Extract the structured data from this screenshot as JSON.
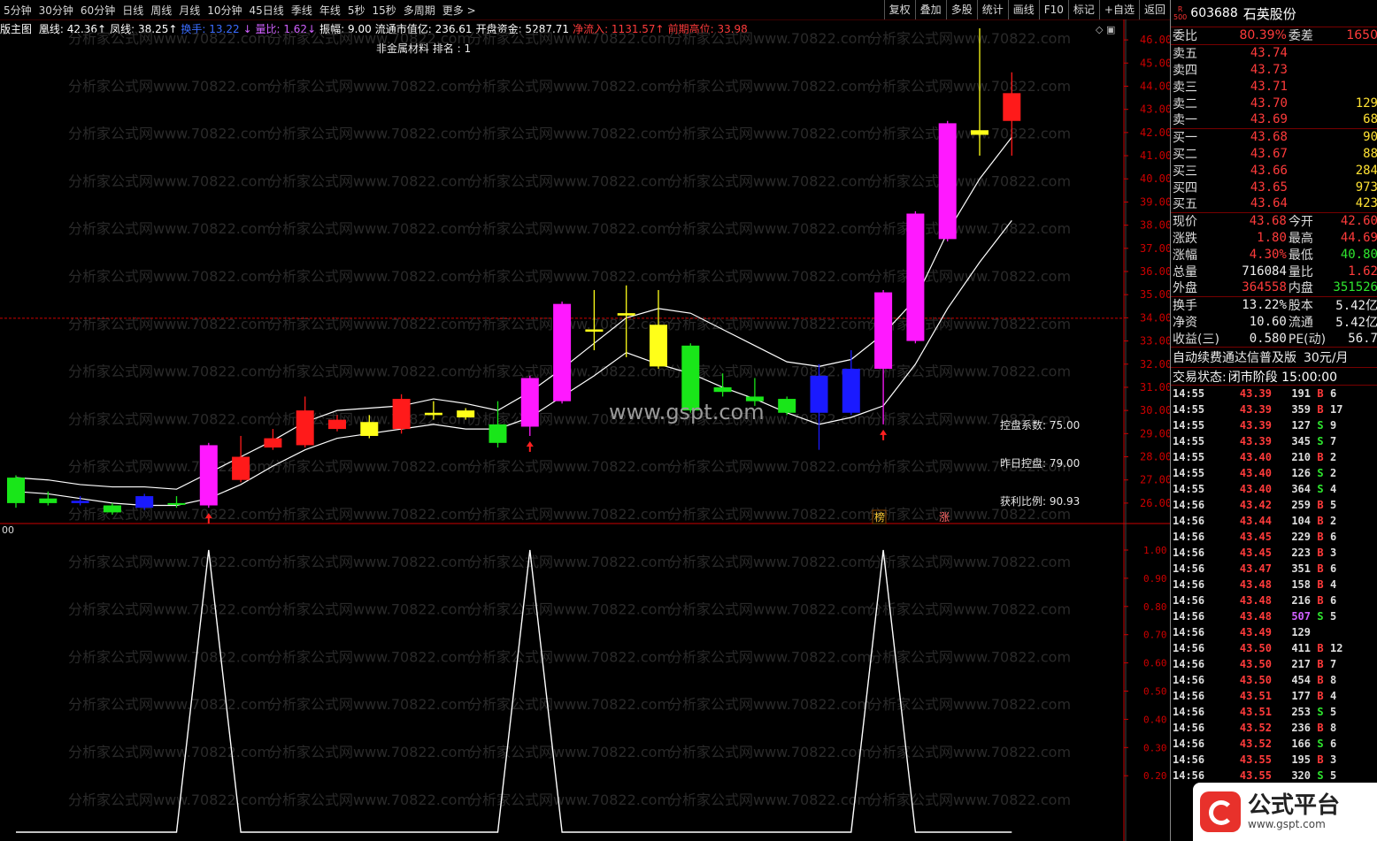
{
  "topbar": {
    "periods": [
      "5分钟",
      "30分钟",
      "60分钟",
      "日线",
      "周线",
      "月线",
      "10分钟",
      "45日线",
      "季线",
      "年线",
      "5秒",
      "15秒",
      "多周期",
      "更多 >"
    ],
    "tools": [
      "复权",
      "叠加",
      "多股",
      "统计",
      "画线",
      "F10",
      "标记",
      "+自选",
      "返回"
    ]
  },
  "infobar": {
    "main_label": "版主图",
    "items": [
      {
        "text": "凰线: 42.36↑",
        "color": "#ffffff"
      },
      {
        "text": "凤线: 38.25↑",
        "color": "#ffffff"
      },
      {
        "text": "换手: 13.22",
        "color": "#3a6cff"
      },
      {
        "text": "↓ 量比: 1.62↓",
        "color": "#d060ff"
      },
      {
        "text": "振幅: 9.00",
        "color": "#ffffff"
      },
      {
        "text": "流通市值亿: 236.61",
        "color": "#ffffff"
      },
      {
        "text": "开盘资金: 5287.71",
        "color": "#ffffff"
      },
      {
        "text": "净流入: 1131.57↑",
        "color": "#ff3b3b"
      },
      {
        "text": "前期高位: 33.98",
        "color": "#ff3b3b"
      }
    ]
  },
  "subtitle": "非金属材料 排名 : 1",
  "panel_info": {
    "control_coef": "控盘系数: 75.00",
    "yesterday_control": "昨日控盘: 79.00",
    "profit_ratio": "获利比例: 90.93"
  },
  "watermark": "分析家公式网www.70822.com",
  "site_watermark": "www.gspt.com",
  "markers": {
    "bang": "榜",
    "zhang": "涨"
  },
  "subpanel_label": "00",
  "colors": {
    "bg": "#000000",
    "magenta": "#ff19ff",
    "red": "#ff1a1a",
    "green": "#19e619",
    "yellow": "#ffff19",
    "blue": "#1a1aff",
    "axis_red": "#cc0000",
    "grid_dashed": "#cc0000",
    "line": "#ffffff",
    "up_text": "#ff3b3b",
    "down_text": "#2fe62f"
  },
  "chart_data": [
    {
      "type": "candlestick",
      "title": "",
      "y_ticks": [
        "46.00",
        "45.00",
        "44.00",
        "43.00",
        "42.00",
        "41.00",
        "40.00",
        "39.00",
        "38.00",
        "37.00",
        "36.00",
        "35.00",
        "34.00",
        "33.00",
        "32.00",
        "31.00",
        "30.00",
        "29.00",
        "28.00",
        "27.00",
        "26.00"
      ],
      "ylim": [
        25.5,
        46.5
      ],
      "reference_line": 33.98,
      "candles": [
        {
          "o": 27.1,
          "c": 26.0,
          "h": 27.2,
          "l": 25.8,
          "color": "green"
        },
        {
          "o": 26.2,
          "c": 26.0,
          "h": 26.5,
          "l": 25.9,
          "color": "green"
        },
        {
          "o": 26.1,
          "c": 26.0,
          "h": 26.3,
          "l": 25.9,
          "color": "blue"
        },
        {
          "o": 25.9,
          "c": 25.6,
          "h": 26.0,
          "l": 25.5,
          "color": "green"
        },
        {
          "o": 26.3,
          "c": 25.8,
          "h": 26.4,
          "l": 25.7,
          "color": "blue"
        },
        {
          "o": 26.0,
          "c": 26.0,
          "h": 26.3,
          "l": 25.8,
          "color": "green"
        },
        {
          "o": 25.9,
          "c": 28.5,
          "h": 28.6,
          "l": 25.8,
          "color": "magenta"
        },
        {
          "o": 27.0,
          "c": 28.0,
          "h": 28.9,
          "l": 26.9,
          "color": "red"
        },
        {
          "o": 28.4,
          "c": 28.8,
          "h": 29.2,
          "l": 28.3,
          "color": "red"
        },
        {
          "o": 28.5,
          "c": 30.0,
          "h": 30.6,
          "l": 28.4,
          "color": "red"
        },
        {
          "o": 29.2,
          "c": 29.6,
          "h": 29.8,
          "l": 29.1,
          "color": "red"
        },
        {
          "o": 28.9,
          "c": 29.5,
          "h": 29.8,
          "l": 28.8,
          "color": "yellow"
        },
        {
          "o": 29.2,
          "c": 30.5,
          "h": 30.7,
          "l": 29.0,
          "color": "red"
        },
        {
          "o": 29.9,
          "c": 29.8,
          "h": 30.4,
          "l": 29.6,
          "color": "yellow"
        },
        {
          "o": 29.7,
          "c": 30.0,
          "h": 30.1,
          "l": 29.6,
          "color": "yellow"
        },
        {
          "o": 29.4,
          "c": 28.6,
          "h": 30.4,
          "l": 28.4,
          "color": "green"
        },
        {
          "o": 29.3,
          "c": 31.4,
          "h": 31.5,
          "l": 28.9,
          "color": "magenta"
        },
        {
          "o": 30.4,
          "c": 34.6,
          "h": 34.7,
          "l": 30.3,
          "color": "magenta"
        },
        {
          "o": 33.4,
          "c": 33.5,
          "h": 35.2,
          "l": 32.6,
          "color": "yellow"
        },
        {
          "o": 34.2,
          "c": 34.1,
          "h": 35.4,
          "l": 32.3,
          "color": "yellow"
        },
        {
          "o": 33.7,
          "c": 31.9,
          "h": 35.2,
          "l": 31.8,
          "color": "yellow"
        },
        {
          "o": 32.8,
          "c": 30.0,
          "h": 32.9,
          "l": 29.9,
          "color": "green"
        },
        {
          "o": 31.0,
          "c": 30.8,
          "h": 31.6,
          "l": 30.6,
          "color": "green"
        },
        {
          "o": 30.6,
          "c": 30.4,
          "h": 31.4,
          "l": 30.2,
          "color": "green"
        },
        {
          "o": 30.5,
          "c": 29.9,
          "h": 30.6,
          "l": 29.8,
          "color": "green"
        },
        {
          "o": 29.9,
          "c": 31.5,
          "h": 32.0,
          "l": 28.3,
          "color": "blue"
        },
        {
          "o": 29.9,
          "c": 31.8,
          "h": 32.6,
          "l": 29.8,
          "color": "blue"
        },
        {
          "o": 31.8,
          "c": 35.1,
          "h": 35.2,
          "l": 29.4,
          "color": "magenta"
        },
        {
          "o": 33.0,
          "c": 38.5,
          "h": 38.6,
          "l": 32.9,
          "color": "magenta"
        },
        {
          "o": 37.4,
          "c": 42.4,
          "h": 42.5,
          "l": 37.3,
          "color": "magenta"
        },
        {
          "o": 41.9,
          "c": 42.1,
          "h": 46.5,
          "l": 41.0,
          "color": "yellow"
        },
        {
          "o": 42.5,
          "c": 43.7,
          "h": 44.6,
          "l": 41.0,
          "color": "red"
        }
      ],
      "series": [
        {
          "values": [
            27.1,
            27.0,
            26.8,
            26.7,
            26.7,
            26.6,
            27.3,
            28.0,
            28.7,
            29.5,
            30.0,
            30.1,
            30.2,
            30.5,
            30.3,
            30.0,
            30.8,
            31.8,
            32.9,
            34.0,
            34.4,
            34.2,
            33.5,
            32.8,
            32.1,
            31.9,
            32.2,
            33.3,
            34.8,
            37.7,
            40.0,
            41.8
          ]
        },
        {
          "values": [
            26.5,
            26.4,
            26.2,
            26.0,
            25.9,
            25.9,
            26.2,
            26.8,
            27.6,
            28.3,
            28.8,
            29.0,
            29.2,
            29.4,
            29.2,
            29.2,
            29.7,
            30.6,
            31.5,
            32.5,
            32.0,
            31.6,
            31.0,
            30.5,
            29.9,
            29.4,
            29.7,
            30.2,
            32.0,
            34.4,
            36.4,
            38.2
          ]
        }
      ],
      "up_arrows_at": [
        6,
        16,
        27
      ]
    },
    {
      "type": "line",
      "title": "",
      "y_ticks": [
        "1.00",
        "0.90",
        "0.80",
        "0.70",
        "0.60",
        "0.50",
        "0.40",
        "0.30",
        "0.20"
      ],
      "ylim": [
        0,
        1.0
      ],
      "values": [
        0,
        0,
        0,
        0,
        0,
        0,
        1,
        0,
        0,
        0,
        0,
        0,
        0,
        0,
        0,
        0,
        1,
        0,
        0,
        0,
        0,
        0,
        0,
        0,
        0,
        0,
        0,
        1,
        0,
        0,
        0,
        0
      ]
    }
  ],
  "quote": {
    "badge_top": "R",
    "badge_bottom": "500",
    "code": "603688",
    "name": "石英股份",
    "weibi": {
      "label": "委比",
      "val": "80.39%",
      "label2": "委差",
      "val2": "1650"
    },
    "asks": [
      {
        "label": "卖五",
        "price": "43.74",
        "vol": ""
      },
      {
        "label": "卖四",
        "price": "43.73",
        "vol": ""
      },
      {
        "label": "卖三",
        "price": "43.71",
        "vol": ""
      },
      {
        "label": "卖二",
        "price": "43.70",
        "vol": "129"
      },
      {
        "label": "卖一",
        "price": "43.69",
        "vol": "68"
      }
    ],
    "bids": [
      {
        "label": "买一",
        "price": "43.68",
        "vol": "90"
      },
      {
        "label": "买二",
        "price": "43.67",
        "vol": "88"
      },
      {
        "label": "买三",
        "price": "43.66",
        "vol": "284"
      },
      {
        "label": "买四",
        "price": "43.65",
        "vol": "973"
      },
      {
        "label": "买五",
        "price": "43.64",
        "vol": "423"
      }
    ],
    "stats": [
      {
        "l1": "现价",
        "v1": "43.68",
        "c1": "red",
        "l2": "今开",
        "v2": "42.60",
        "c2": "red"
      },
      {
        "l1": "涨跌",
        "v1": "1.80",
        "c1": "red",
        "l2": "最高",
        "v2": "44.69",
        "c2": "red"
      },
      {
        "l1": "涨幅",
        "v1": "4.30%",
        "c1": "red",
        "l2": "最低",
        "v2": "40.80",
        "c2": "green"
      },
      {
        "l1": "总量",
        "v1": "716084",
        "c1": "white",
        "l2": "量比",
        "v2": "1.62",
        "c2": "red"
      },
      {
        "l1": "外盘",
        "v1": "364558",
        "c1": "red",
        "l2": "内盘",
        "v2": "351526",
        "c2": "green"
      }
    ],
    "stats2": [
      {
        "l1": "换手",
        "v1": "13.22%",
        "l2": "股本",
        "v2": "5.42亿"
      },
      {
        "l1": "净资",
        "v1": "10.60",
        "l2": "流通",
        "v2": "5.42亿"
      },
      {
        "l1": "收益(三)",
        "v1": "0.580",
        "l2": "PE(动)",
        "v2": "56.7"
      }
    ],
    "promo_text": "自动续费通达信普及版",
    "promo_price": "30元/月",
    "status_label": "交易状态:",
    "status_value": "闭市阶段 15:00:00",
    "ticks": [
      {
        "t": "14:55",
        "p": "43.39",
        "v": "191",
        "bs": "B",
        "n": "6"
      },
      {
        "t": "14:55",
        "p": "43.39",
        "v": "359",
        "bs": "B",
        "n": "17"
      },
      {
        "t": "14:55",
        "p": "43.39",
        "v": "127",
        "bs": "S",
        "n": "9"
      },
      {
        "t": "14:55",
        "p": "43.39",
        "v": "345",
        "bs": "S",
        "n": "7"
      },
      {
        "t": "14:55",
        "p": "43.40",
        "v": "210",
        "bs": "B",
        "n": "2"
      },
      {
        "t": "14:55",
        "p": "43.40",
        "v": "126",
        "bs": "S",
        "n": "2"
      },
      {
        "t": "14:55",
        "p": "43.40",
        "v": "364",
        "bs": "S",
        "n": "4"
      },
      {
        "t": "14:56",
        "p": "43.42",
        "v": "259",
        "bs": "B",
        "n": "5"
      },
      {
        "t": "14:56",
        "p": "43.44",
        "v": "104",
        "bs": "B",
        "n": "2"
      },
      {
        "t": "14:56",
        "p": "43.45",
        "v": "229",
        "bs": "B",
        "n": "6"
      },
      {
        "t": "14:56",
        "p": "43.45",
        "v": "223",
        "bs": "B",
        "n": "3"
      },
      {
        "t": "14:56",
        "p": "43.47",
        "v": "351",
        "bs": "B",
        "n": "6"
      },
      {
        "t": "14:56",
        "p": "43.48",
        "v": "158",
        "bs": "B",
        "n": "4"
      },
      {
        "t": "14:56",
        "p": "43.48",
        "v": "216",
        "bs": "B",
        "n": "6"
      },
      {
        "t": "14:56",
        "p": "43.48",
        "v": "507",
        "bs": "S",
        "n": "5"
      },
      {
        "t": "14:56",
        "p": "43.49",
        "v": "129",
        "bs": "",
        "n": ""
      },
      {
        "t": "14:56",
        "p": "43.50",
        "v": "411",
        "bs": "B",
        "n": "12"
      },
      {
        "t": "14:56",
        "p": "43.50",
        "v": "217",
        "bs": "B",
        "n": "7"
      },
      {
        "t": "14:56",
        "p": "43.50",
        "v": "454",
        "bs": "B",
        "n": "8"
      },
      {
        "t": "14:56",
        "p": "43.51",
        "v": "177",
        "bs": "B",
        "n": "4"
      },
      {
        "t": "14:56",
        "p": "43.51",
        "v": "253",
        "bs": "S",
        "n": "5"
      },
      {
        "t": "14:56",
        "p": "43.52",
        "v": "236",
        "bs": "B",
        "n": "8"
      },
      {
        "t": "14:56",
        "p": "43.52",
        "v": "166",
        "bs": "S",
        "n": "6"
      },
      {
        "t": "14:56",
        "p": "43.55",
        "v": "195",
        "bs": "B",
        "n": "3"
      },
      {
        "t": "14:56",
        "p": "43.55",
        "v": "320",
        "bs": "S",
        "n": "5"
      }
    ]
  },
  "logo": {
    "title": "公式平台",
    "url": "www.gspt.com"
  }
}
